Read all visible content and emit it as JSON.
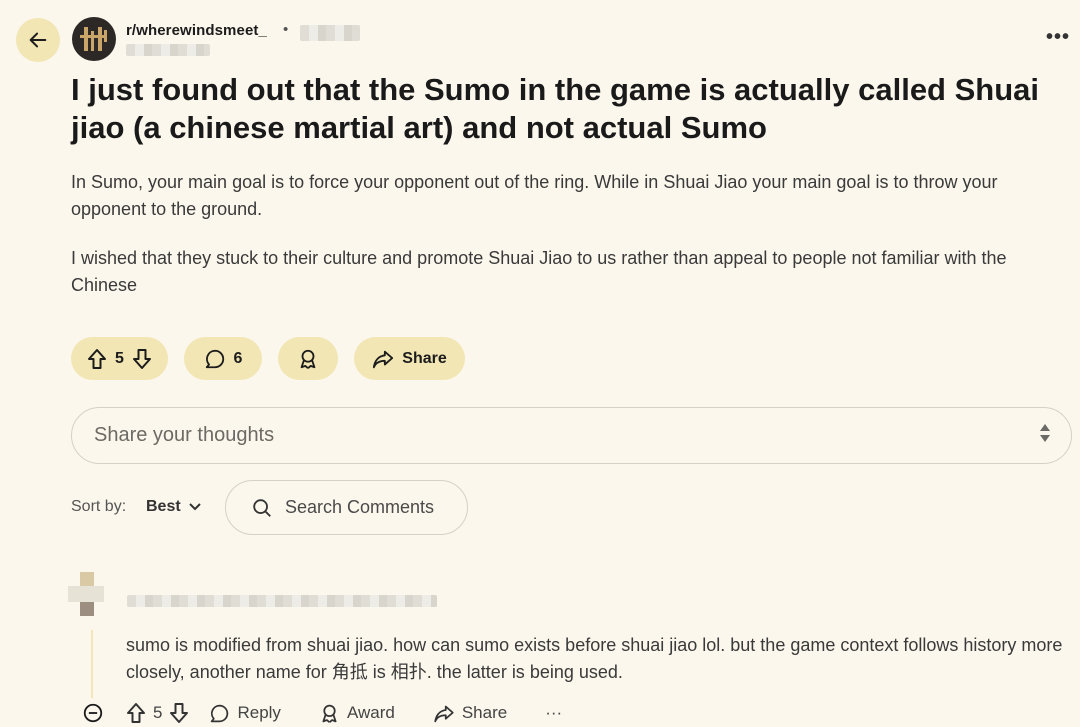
{
  "header": {
    "subreddit": "r/wherewindsmeet_",
    "separator": "•",
    "more_label": "•••"
  },
  "post": {
    "title": "I just found out that the Sumo in the game is actually called Shuai jiao (a chinese martial art) and not actual Sumo",
    "paragraphs": [
      "In Sumo, your main goal is to force your opponent out of the ring. While in Shuai Jiao your main goal is to throw your opponent to the ground.",
      "I wished that they stuck to their culture and promote Shuai Jiao to us rather than appeal to people not familiar with the Chinese"
    ]
  },
  "actions": {
    "votes": "5",
    "comments": "6",
    "share_label": "Share"
  },
  "composer": {
    "placeholder": "Share your thoughts"
  },
  "sort": {
    "label": "Sort by:",
    "value": "Best"
  },
  "search": {
    "placeholder": "Search Comments"
  },
  "comment": {
    "text": "sumo is modified from shuai jiao. how can sumo exists before shuai jiao lol. but the game context follows history more closely, another name for 角抵 is 相扑. the latter is being used.",
    "votes": "5",
    "reply_label": "Reply",
    "award_label": "Award",
    "share_label": "Share",
    "more_label": "···"
  },
  "colors": {
    "background": "#fbf7ec",
    "pill": "#f2e6b4",
    "border": "#d6d1c4"
  }
}
